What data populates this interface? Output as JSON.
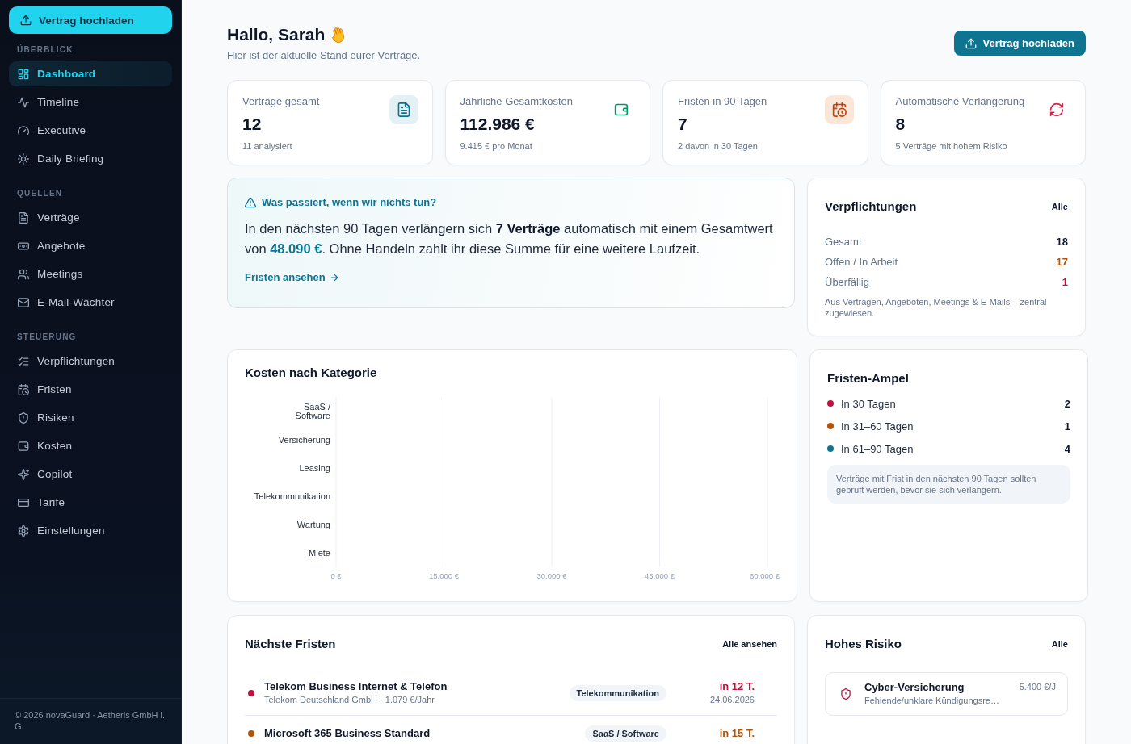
{
  "sidebar": {
    "upload_button": "Vertrag hochladen",
    "sections": [
      {
        "title": "ÜBERBLICK",
        "items": [
          {
            "label": "Dashboard",
            "selected": true
          },
          {
            "label": "Timeline",
            "selected": false
          },
          {
            "label": "Executive",
            "selected": false
          },
          {
            "label": "Daily Briefing",
            "selected": false
          }
        ]
      },
      {
        "title": "QUELLEN",
        "items": [
          {
            "label": "Verträge",
            "selected": false
          },
          {
            "label": "Angebote",
            "selected": false
          },
          {
            "label": "Meetings",
            "selected": false
          },
          {
            "label": "E-Mail-Wächter",
            "selected": false
          }
        ]
      },
      {
        "title": "STEUERUNG",
        "items": [
          {
            "label": "Verpflichtungen",
            "selected": false
          },
          {
            "label": "Fristen",
            "selected": false
          },
          {
            "label": "Risiken",
            "selected": false
          },
          {
            "label": "Kosten",
            "selected": false
          },
          {
            "label": "Copilot",
            "selected": false
          },
          {
            "label": "Tarife",
            "selected": false
          },
          {
            "label": "Einstellungen",
            "selected": false
          }
        ]
      }
    ],
    "footer": "© 2026 novaGuard · Aetheris GmbH i. G."
  },
  "header": {
    "greeting": "Hallo, Sarah",
    "subtitle": "Hier ist der aktuelle Stand eurer Verträge.",
    "upload_button": "Vertrag hochladen"
  },
  "stats": [
    {
      "label": "Verträge gesamt",
      "value": "12",
      "note": "11 analysiert"
    },
    {
      "label": "Jährliche Gesamtkosten",
      "value": "112.986 €",
      "note": "9.415 € pro Monat"
    },
    {
      "label": "Fristen in 90 Tagen",
      "value": "7",
      "note": "2 davon in 30 Tagen"
    },
    {
      "label": "Automatische Verlängerung",
      "value": "8",
      "note": "5 Verträge mit hohem Risiko"
    }
  ],
  "alert": {
    "title": "Was passiert, wenn wir nichts tun?",
    "text": "In den nächsten 90 Tagen verlängern sich **7 Verträge** automatisch mit einem Gesamtwert von **48.090 €**. Ohne Handeln zahlt ihr diese Summe für eine weitere Laufzeit.",
    "link": "Fristen ansehen"
  },
  "obligations": {
    "title": "Verpflichtungen",
    "link": "Alle",
    "rows": [
      {
        "label": "Gesamt",
        "value": "18",
        "color": "#0f172a"
      },
      {
        "label": "Offen / In Arbeit",
        "value": "17",
        "color": "#b45309"
      },
      {
        "label": "Überfällig",
        "value": "1",
        "color": "#be123c"
      }
    ],
    "note": "Aus Verträgen, Angeboten, Meetings & E-Mails – zentral zugewiesen."
  },
  "costs": {
    "chart_data": {
      "type": "bar",
      "orientation": "horizontal",
      "title": "Kosten nach Kategorie",
      "categories": [
        "SaaS / Software",
        "Versicherung",
        "Leasing",
        "Telekommunikation",
        "Wartung",
        "Miete"
      ],
      "values": [
        null,
        null,
        null,
        null,
        null,
        null
      ],
      "xlim": [
        0,
        60000
      ],
      "xticks": [
        {
          "value": 0,
          "label": "0 €"
        },
        {
          "value": 15000,
          "label": "15.000 €"
        },
        {
          "value": 30000,
          "label": "30.000 €"
        },
        {
          "value": 45000,
          "label": "45.000 €"
        },
        {
          "value": 60000,
          "label": "60.000 €"
        }
      ],
      "grid": true
    }
  },
  "traffic_light": {
    "title": "Fristen-Ampel",
    "rows": [
      {
        "label": "In 30 Tagen",
        "count": "2",
        "color": "#be123c"
      },
      {
        "label": "In 31–60 Tagen",
        "count": "1",
        "color": "#b45309"
      },
      {
        "label": "In 61–90 Tagen",
        "count": "4",
        "color": "#0e7490"
      }
    ],
    "note": "Verträge mit Frist in den nächsten 90 Tagen sollten geprüft werden, bevor sie sich verlängern."
  },
  "deadlines": {
    "title": "Nächste Fristen",
    "link": "Alle ansehen",
    "rows": [
      {
        "name": "Telekom Business Internet & Telefon",
        "detail": "Telekom Deutschland GmbH · 1.079 €/Jahr",
        "category": "Telekommunikation",
        "due": "in 12 T.",
        "date": "24.06.2026",
        "color": "#be123c"
      },
      {
        "name": "Microsoft 365 Business Standard",
        "category": "SaaS / Software",
        "due": "in 15 T.",
        "color": "#b45309"
      }
    ]
  },
  "high_risk": {
    "title": "Hohes Risiko",
    "link": "Alle",
    "items": [
      {
        "name": "Cyber-Versicherung",
        "reason": "Fehlende/unklare Kündigungsre…",
        "price": "5.400 €/J."
      }
    ]
  }
}
